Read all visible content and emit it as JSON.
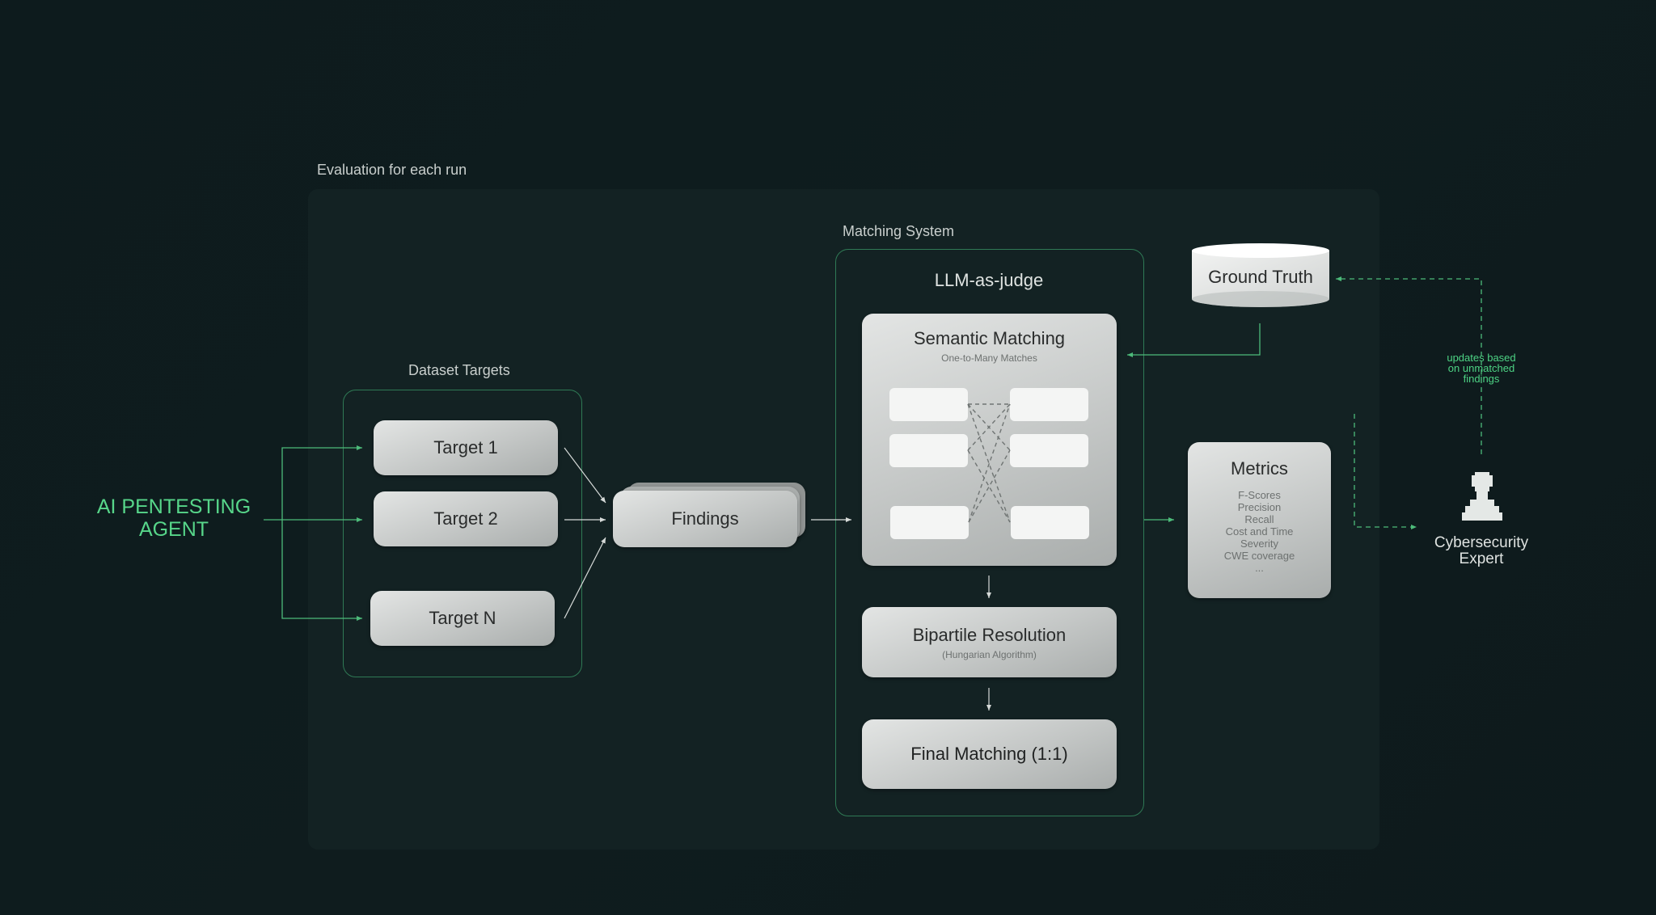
{
  "panel": {
    "title": "Evaluation for each run"
  },
  "agent": {
    "line1": "AI PENTESTING",
    "line2": "AGENT"
  },
  "dataset": {
    "title": "Dataset Targets",
    "targets": [
      "Target 1",
      "Target 2",
      "Target N"
    ]
  },
  "findings": {
    "label": "Findings"
  },
  "matching": {
    "title": "Matching System",
    "judge": "LLM-as-judge",
    "semantic": {
      "title": "Semantic Matching",
      "subtitle": "One-to-Many Matches"
    },
    "bipartite": {
      "title": "Bipartile Resolution",
      "subtitle": "(Hungarian Algorithm)"
    },
    "final": {
      "title": "Final Matching (1:1)"
    }
  },
  "ground_truth": {
    "label": "Ground Truth"
  },
  "metrics": {
    "title": "Metrics",
    "items": [
      "F-Scores",
      "Precision",
      "Recall",
      "Cost and Time",
      "Severity",
      "CWE coverage",
      "..."
    ]
  },
  "feedback": {
    "line1": "updates based",
    "line2": "on unmatched",
    "line3": "findings"
  },
  "expert": {
    "line1": "Cybersecurity",
    "line2": "Expert"
  },
  "colors": {
    "accent": "#4dd384",
    "panel": "#132223",
    "border": "#2f7a55",
    "box": "#c4c7c6"
  }
}
